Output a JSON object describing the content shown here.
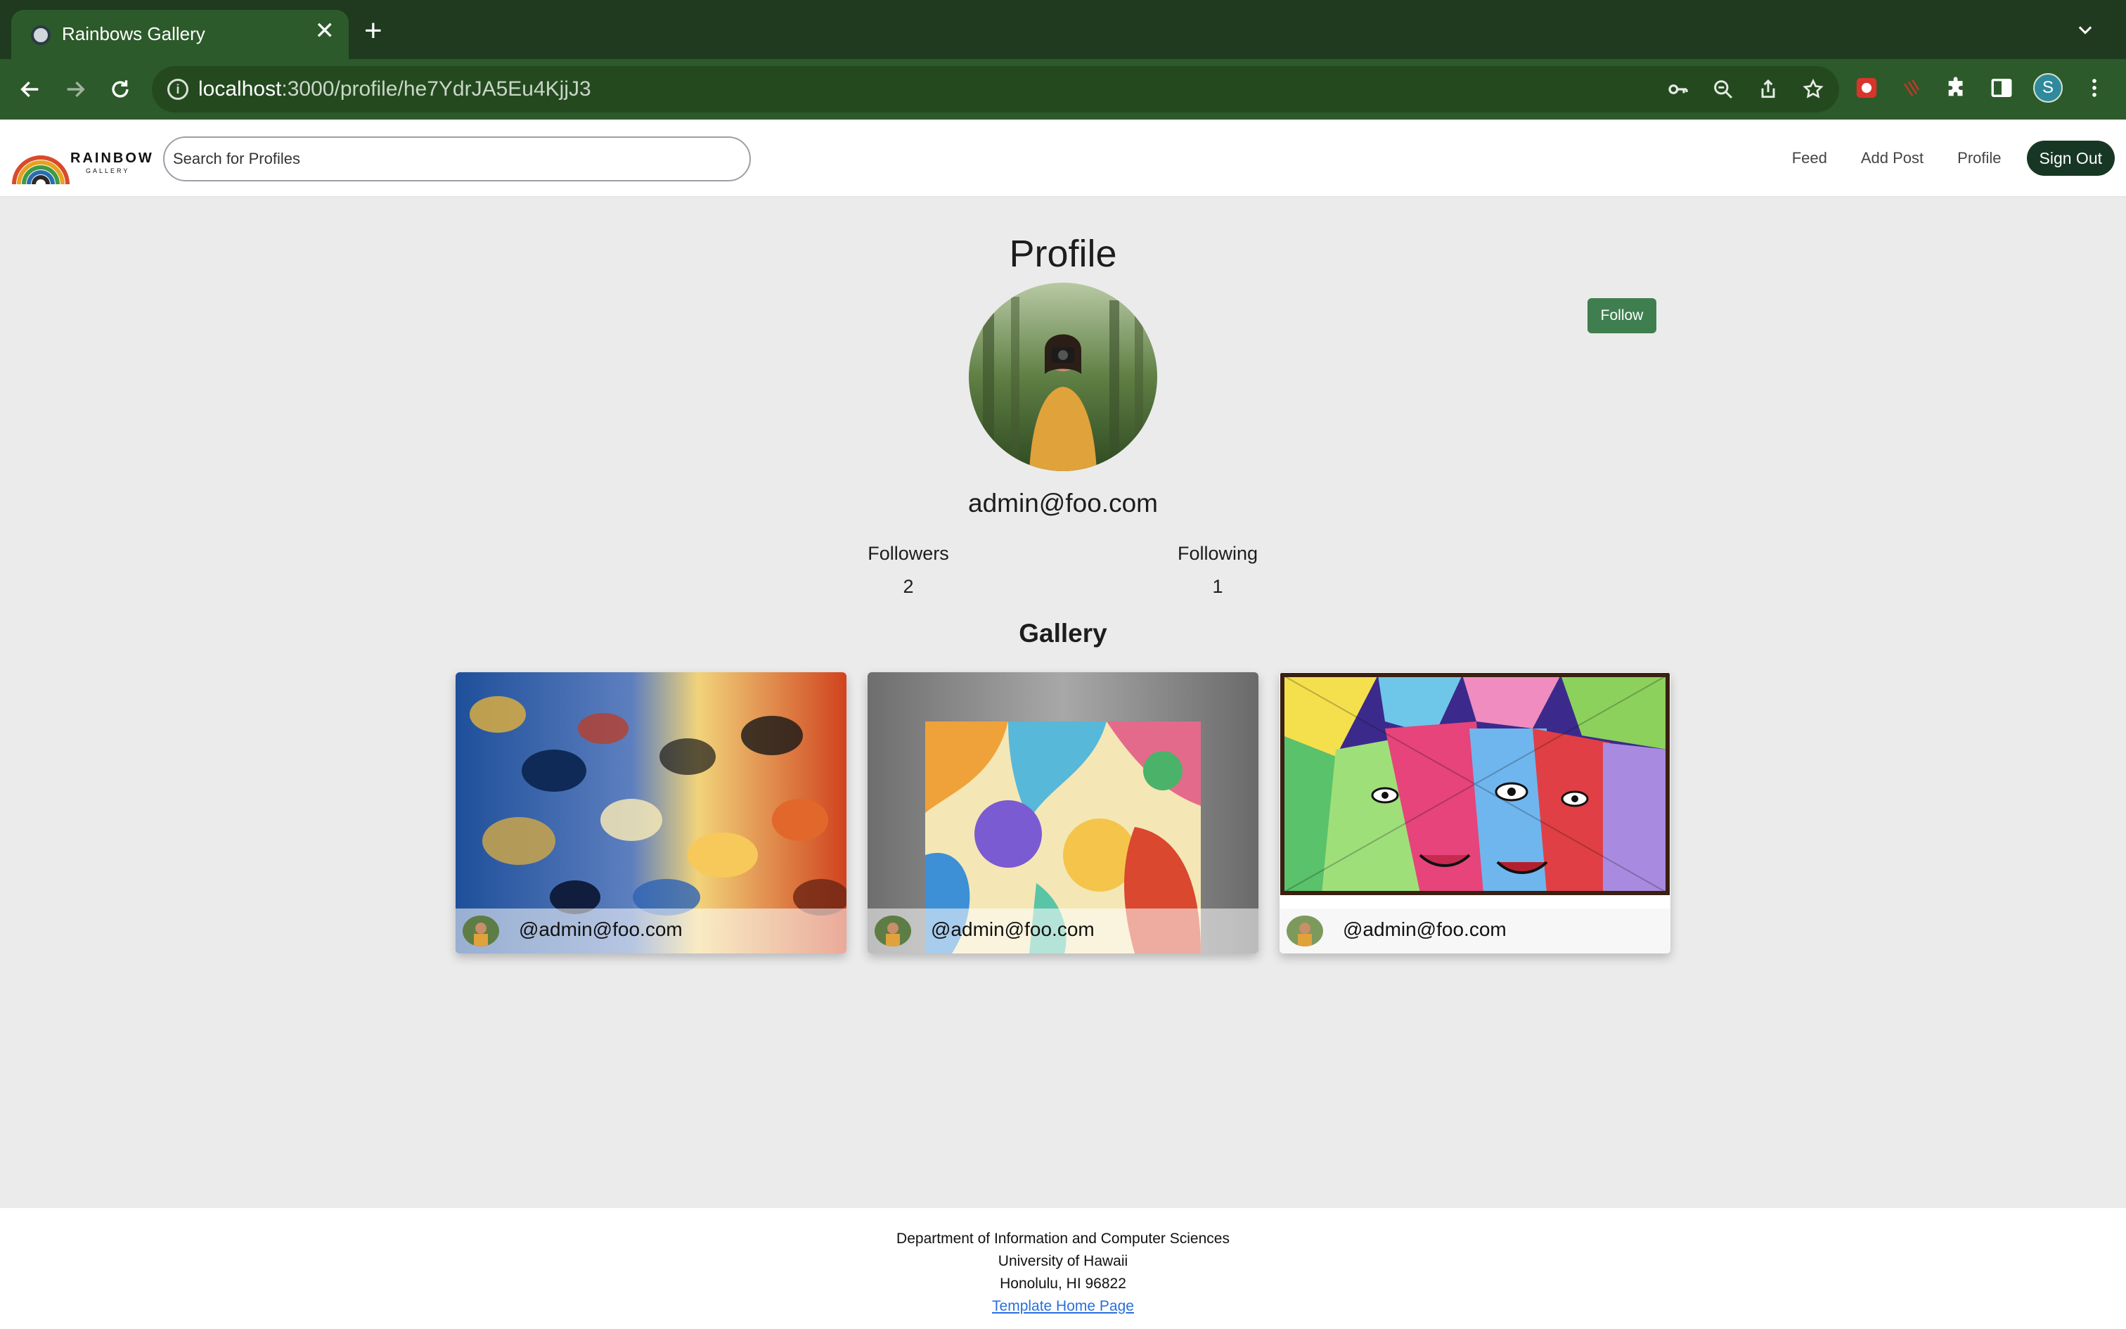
{
  "browser": {
    "tab_title": "Rainbows Gallery",
    "tab_close": "✕",
    "new_tab": "+",
    "url_host": "localhost",
    "url_path": ":3000/profile/he7YdrJA5Eu4KjjJ3",
    "profile_initial": "S"
  },
  "navbar": {
    "logo_word": "RAINBOW",
    "logo_sub": "GALLERY",
    "search_placeholder": "Search for Profiles",
    "links": [
      "Feed",
      "Add Post",
      "Profile"
    ],
    "signout_label": "Sign Out"
  },
  "profile": {
    "page_title": "Profile",
    "follow_label": "Follow",
    "email": "admin@foo.com",
    "followers_label": "Followers",
    "followers_count": "2",
    "following_label": "Following",
    "following_count": "1"
  },
  "gallery": {
    "title": "Gallery",
    "posts": [
      {
        "user": "@admin@foo.com"
      },
      {
        "user": "@admin@foo.com"
      },
      {
        "user": "@admin@foo.com"
      }
    ]
  },
  "footer": {
    "line1": "Department of Information and Computer Sciences",
    "line2": "University of Hawaii",
    "line3": "Honolulu, HI 96822",
    "link": "Template Home Page"
  },
  "colors": {
    "chrome_dark": "#1f3a1e",
    "chrome_bar": "#2c5a2a",
    "signout_bg": "#173724",
    "follow_bg": "#3f7f4f",
    "page_bg": "#ebebeb"
  }
}
